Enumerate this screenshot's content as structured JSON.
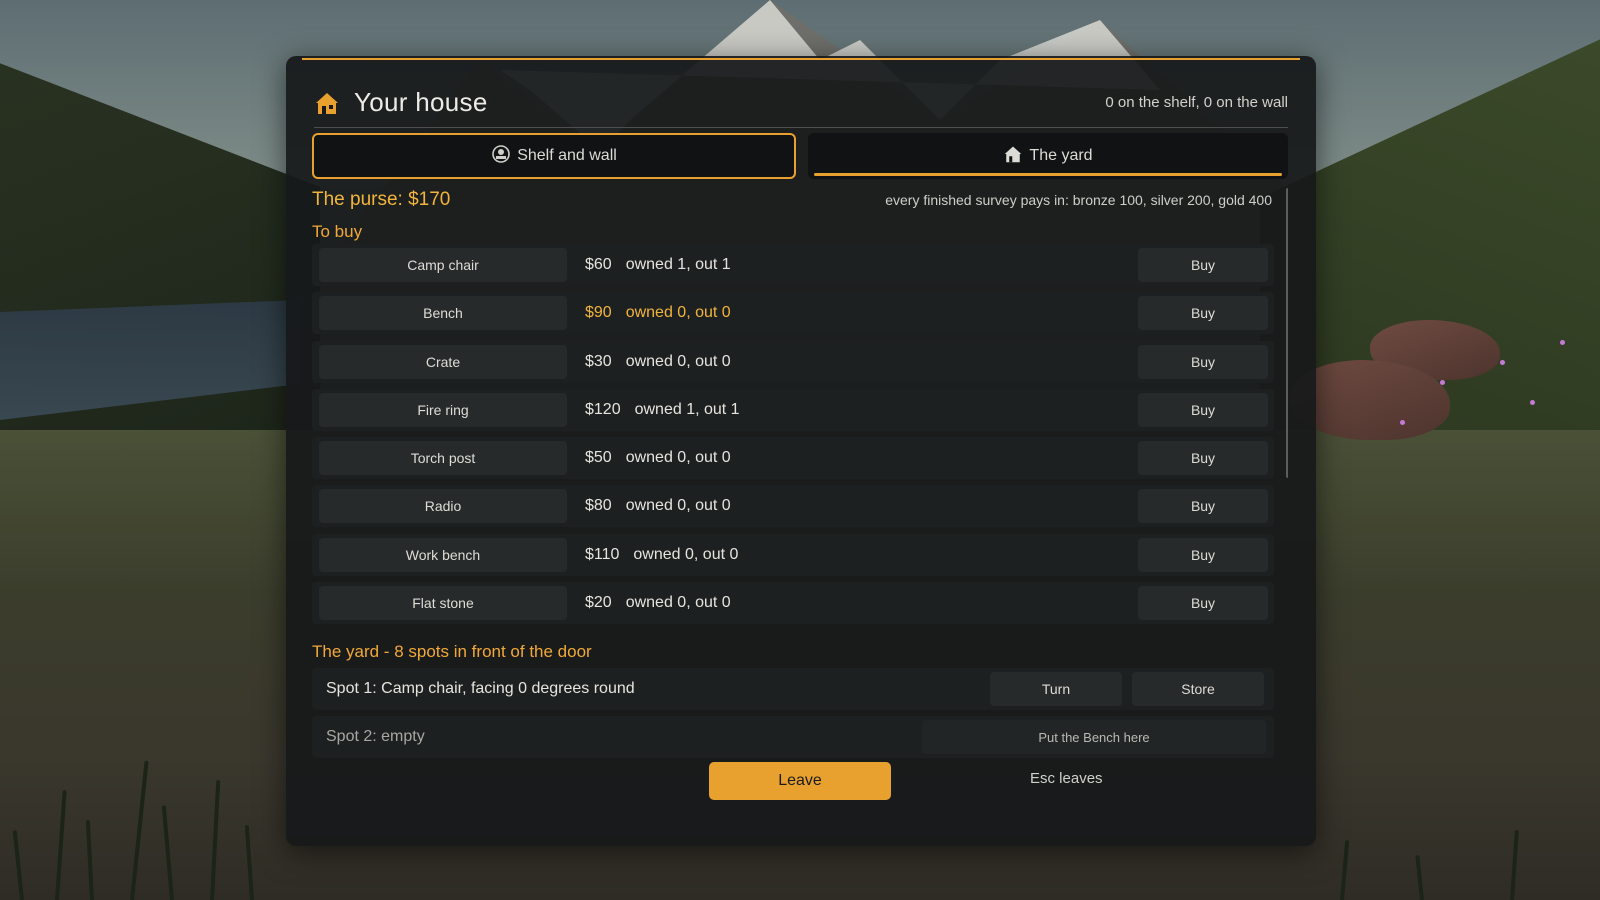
{
  "header": {
    "title": "Your house",
    "icon": "house-icon",
    "status": "0 on the shelf, 0 on the wall"
  },
  "tabs": [
    {
      "label": "Shelf and wall",
      "icon": "shelf-icon"
    },
    {
      "label": "The yard",
      "icon": "house-icon"
    }
  ],
  "purse": {
    "label": "The purse: $170",
    "survey_note": "every finished survey pays in: bronze 100, silver 200, gold 400"
  },
  "shop": {
    "section_title": "To buy",
    "buy_label": "Buy",
    "items": [
      {
        "name": "Camp chair",
        "price": "$60",
        "owned": "owned 1, out 1"
      },
      {
        "name": "Bench",
        "price": "$90",
        "owned": "owned 0, out 0"
      },
      {
        "name": "Crate",
        "price": "$30",
        "owned": "owned 0, out 0"
      },
      {
        "name": "Fire ring",
        "price": "$120",
        "owned": "owned 1, out 1"
      },
      {
        "name": "Torch post",
        "price": "$50",
        "owned": "owned 0, out 0"
      },
      {
        "name": "Radio",
        "price": "$80",
        "owned": "owned 0, out 0"
      },
      {
        "name": "Work bench",
        "price": "$110",
        "owned": "owned 0, out 0"
      },
      {
        "name": "Flat stone",
        "price": "$20",
        "owned": "owned 0, out 0"
      }
    ]
  },
  "yard": {
    "section_title": "The yard - 8 spots in front of the door",
    "spots": [
      {
        "label": "Spot 1: Camp chair, facing 0 degrees round",
        "turn_label": "Turn",
        "store_label": "Store"
      },
      {
        "label": "Spot 2: empty",
        "place_label": "Put the Bench here"
      }
    ]
  },
  "footer": {
    "leave_label": "Leave",
    "esc_hint": "Esc leaves"
  },
  "colors": {
    "accent": "#e8a12f",
    "panel": "#17191a",
    "row": "#1d2021"
  }
}
